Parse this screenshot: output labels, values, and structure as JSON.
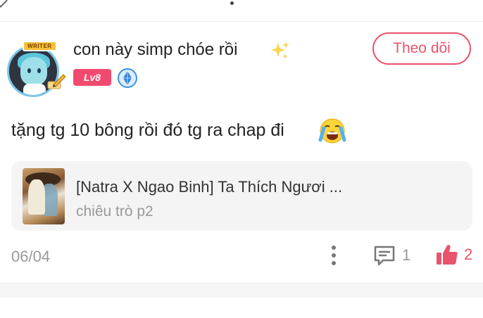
{
  "post": {
    "username": "con này simp chóe rồi",
    "level": "Lv8",
    "writer_badge": "WRITER",
    "follow_label": "Theo dõi",
    "comment": "tặng tg 10 bông rồi đó tg ra chap đi",
    "date": "06/04",
    "reply_count": "1",
    "like_count": "2"
  },
  "story": {
    "title": "[Natra X Ngao Binh] Ta Thích Ngươi ...",
    "chapter": "chiêu trò p2"
  },
  "icons": {
    "sparkle": "sparkle-icon",
    "rank": "rank-diamond-icon",
    "emoji": "crying-face-icon",
    "more": "more-vertical-icon",
    "reply": "comment-icon",
    "like": "thumbs-up-icon"
  },
  "colors": {
    "accent": "#e8546b",
    "level_badge": "#f24a6f",
    "card_bg": "#f4f4f5",
    "muted_text": "#999999"
  }
}
